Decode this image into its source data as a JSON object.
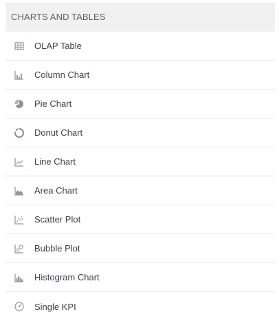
{
  "panel": {
    "header": "CHARTS AND TABLES",
    "items": [
      {
        "label": "OLAP Table",
        "icon": "table-icon"
      },
      {
        "label": "Column Chart",
        "icon": "column-chart-icon"
      },
      {
        "label": "Pie Chart",
        "icon": "pie-chart-icon"
      },
      {
        "label": "Donut Chart",
        "icon": "donut-chart-icon"
      },
      {
        "label": "Line Chart",
        "icon": "line-chart-icon"
      },
      {
        "label": "Area Chart",
        "icon": "area-chart-icon"
      },
      {
        "label": "Scatter Plot",
        "icon": "scatter-plot-icon"
      },
      {
        "label": "Bubble Plot",
        "icon": "bubble-plot-icon"
      },
      {
        "label": "Histogram Chart",
        "icon": "histogram-chart-icon"
      },
      {
        "label": "Single KPI",
        "icon": "kpi-gauge-icon"
      }
    ]
  },
  "colors": {
    "header_bg": "#f1f1f2",
    "header_text": "#5b6068",
    "item_text": "#3b3f45",
    "icon": "#8d949c",
    "divider": "#e6e7e9"
  }
}
